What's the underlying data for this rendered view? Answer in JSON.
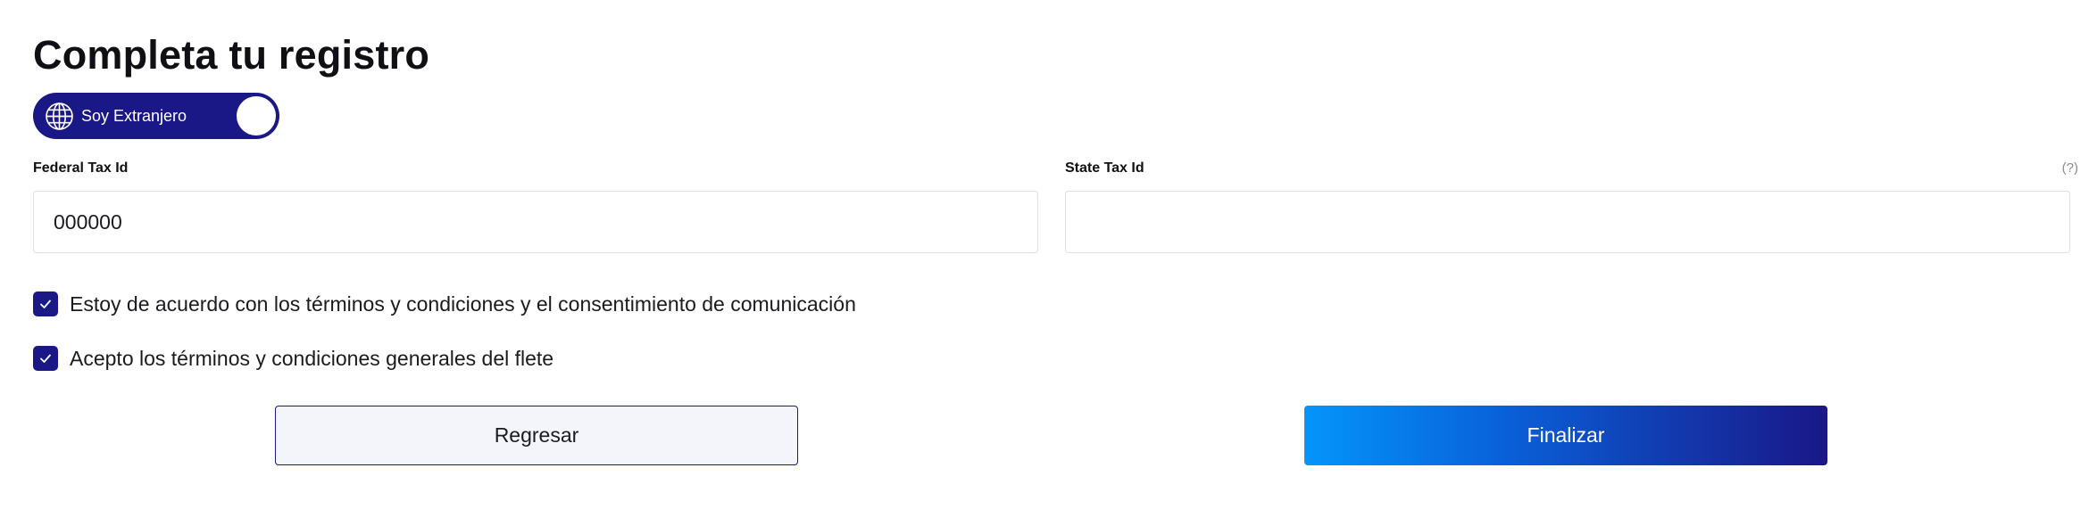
{
  "page": {
    "title": "Completa tu registro"
  },
  "foreigner_toggle": {
    "label": "Soy Extranjero",
    "state": "on",
    "icon": "globe-icon"
  },
  "fields": {
    "federal_tax_id": {
      "label": "Federal Tax Id",
      "value": "000000"
    },
    "state_tax_id": {
      "label": "State Tax Id",
      "value": "",
      "help": "(?)"
    }
  },
  "agreements": [
    {
      "label": "Estoy de acuerdo con los términos y condiciones y el consentimiento de comunicación",
      "checked": true
    },
    {
      "label": "Acepto los términos y condiciones generales del flete",
      "checked": true
    }
  ],
  "actions": {
    "back_label": "Regresar",
    "finish_label": "Finalizar"
  },
  "colors": {
    "primary": "#1a1787",
    "gradient_start": "#0495fb",
    "border": "#dfe0e5"
  }
}
